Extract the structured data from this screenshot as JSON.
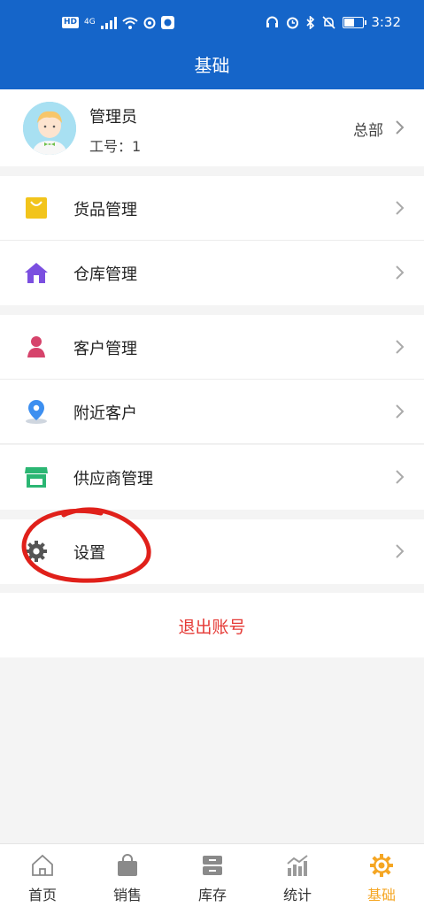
{
  "status_bar": {
    "network": "4G",
    "hd": "HD",
    "time": "3:32"
  },
  "header": {
    "title": "基础"
  },
  "profile": {
    "name": "管理员",
    "employee_id": "工号：1",
    "branch": "总部"
  },
  "menu_groups": [
    {
      "items": [
        {
          "label": "货品管理",
          "icon": "shopping-bag-icon"
        },
        {
          "label": "仓库管理",
          "icon": "house-icon"
        }
      ]
    },
    {
      "items": [
        {
          "label": "客户管理",
          "icon": "person-icon"
        },
        {
          "label": "附近客户",
          "icon": "location-pin-icon"
        },
        {
          "label": "供应商管理",
          "icon": "storefront-icon"
        }
      ]
    },
    {
      "items": [
        {
          "label": "设置",
          "icon": "gear-icon"
        }
      ]
    }
  ],
  "logout": {
    "label": "退出账号"
  },
  "tabbar": {
    "tabs": [
      {
        "label": "首页",
        "icon": "home-icon"
      },
      {
        "label": "销售",
        "icon": "bag-icon"
      },
      {
        "label": "库存",
        "icon": "inventory-icon"
      },
      {
        "label": "统计",
        "icon": "chart-icon"
      },
      {
        "label": "基础",
        "icon": "gear-icon",
        "active": true
      }
    ]
  },
  "colors": {
    "header": "#1565c9",
    "active_tab": "#f5a623",
    "logout": "#e53935",
    "annotation": "#e0201a"
  }
}
